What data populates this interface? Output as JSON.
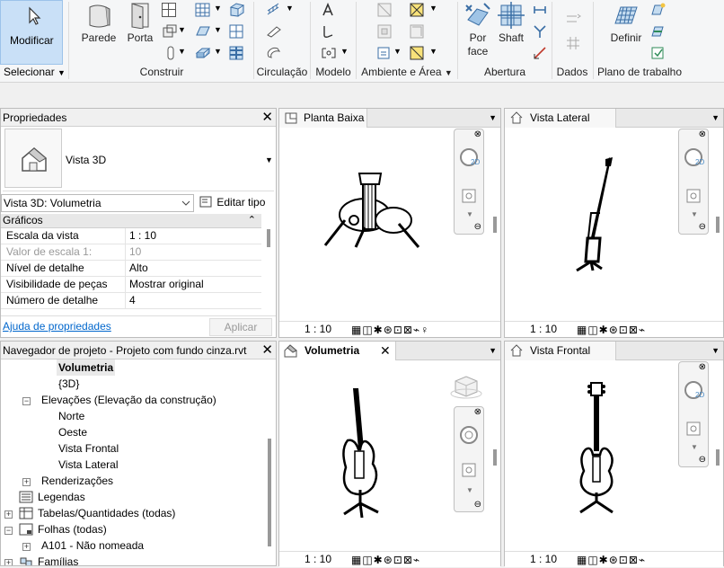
{
  "ribbon": {
    "modify_label": "Modificar",
    "select_label": "Selecionar",
    "buttons": {
      "wall": "Parede",
      "door": "Porta",
      "by_face": [
        "Por",
        "face"
      ],
      "shaft": "Shaft",
      "set": "Definir"
    },
    "groups": {
      "build": "Construir",
      "circulation": "Circulação",
      "model": "Modelo",
      "room_area": "Ambiente e Área",
      "opening": "Abertura",
      "datum": "Dados",
      "workplane": "Plano de trabalho"
    }
  },
  "properties": {
    "title": "Propriedades",
    "type_name": "Vista 3D",
    "instance_select": "Vista 3D: Volumetria",
    "edit_type": "Editar tipo",
    "section": "Gráficos",
    "rows": [
      {
        "key": "Escala da vista",
        "value": "1 : 10",
        "disabled": false
      },
      {
        "key": "Valor de escala    1:",
        "value": "10",
        "disabled": true
      },
      {
        "key": "Nível de detalhe",
        "value": "Alto",
        "disabled": false
      },
      {
        "key": "Visibilidade de peças",
        "value": "Mostrar original",
        "disabled": false
      },
      {
        "key": "Número de detalhe",
        "value": "4",
        "disabled": false
      }
    ],
    "help_link": "Ajuda de propriedades",
    "apply": "Aplicar"
  },
  "browser": {
    "title": "Navegador de projeto - Projeto com fundo cinza.rvt",
    "items": {
      "volumetria": "Volumetria",
      "threed": "{3D}",
      "elevations": "Elevações (Elevação da construção)",
      "norte": "Norte",
      "oeste": "Oeste",
      "vista_frontal": "Vista Frontal",
      "vista_lateral": "Vista Lateral",
      "renderizacoes": "Renderizações",
      "legendas": "Legendas",
      "tabelas": "Tabelas/Quantidades (todas)",
      "folhas": "Folhas (todas)",
      "a101": "A101 - Não nomeada",
      "familias": "Famílias"
    }
  },
  "views": {
    "plan": {
      "title": "Planta Baixa",
      "scale": "1 : 10"
    },
    "side": {
      "title": "Vista Lateral",
      "scale": "1 : 10"
    },
    "volume": {
      "title": "Volumetria",
      "scale": "1 : 10"
    },
    "front": {
      "title": "Vista Frontal",
      "scale": "1 : 10"
    }
  },
  "colors": {
    "accent": "#c9e0f7",
    "link": "#0066cc"
  }
}
